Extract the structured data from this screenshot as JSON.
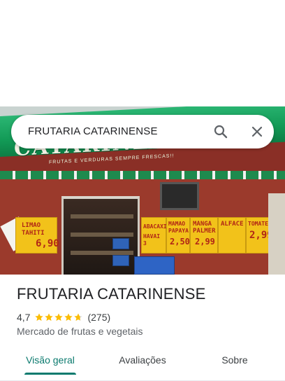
{
  "search": {
    "query": "FRUTARIA CATARINENSE"
  },
  "photo": {
    "storefront_name": "CATARINENSE",
    "awning_tagline": "FRUTAS E VERDURAS SEMPRE FRESCAS!!",
    "posters": [
      {
        "lines": [
          "LIMAO",
          "TAHITI",
          "6,90"
        ]
      },
      {
        "lines": [
          "ABACAXI",
          "HAVAI 3"
        ]
      },
      {
        "lines": [
          "MAMAO",
          "PAPAYA",
          "2,50"
        ]
      },
      {
        "lines": [
          "MANGA",
          "PALMER",
          "2,99"
        ]
      },
      {
        "lines": [
          "ALFACE",
          "",
          ""
        ]
      },
      {
        "lines": [
          "TOMATE",
          "2,99"
        ]
      }
    ]
  },
  "place": {
    "title": "FRUTARIA CATARINENSE",
    "rating": "4,7",
    "stars": 4.7,
    "review_count": "(275)",
    "category": "Mercado de frutas e vegetais"
  },
  "tabs": [
    {
      "label": "Visão geral",
      "active": true
    },
    {
      "label": "Avaliações",
      "active": false
    },
    {
      "label": "Sobre",
      "active": false
    }
  ],
  "colors": {
    "accent": "#0b7a6e",
    "star": "#fbbc04",
    "awning_green": "#129a56",
    "wall_red": "#9b3a2c"
  },
  "icons": {
    "search": "search-icon",
    "close": "close-icon",
    "star": "star-icon"
  }
}
